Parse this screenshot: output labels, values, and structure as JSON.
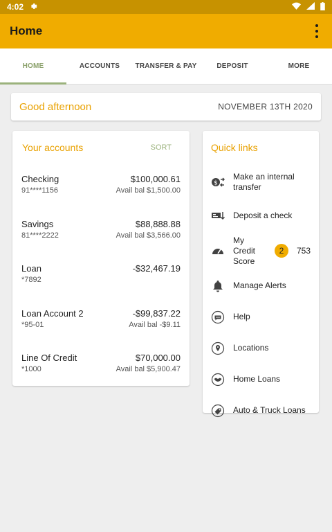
{
  "status": {
    "time": "4:02"
  },
  "appbar": {
    "title": "Home"
  },
  "tabs": [
    {
      "label": "HOME",
      "active": true
    },
    {
      "label": "ACCOUNTS"
    },
    {
      "label": "TRANSFER & PAY"
    },
    {
      "label": "DEPOSIT"
    },
    {
      "label": "MORE"
    }
  ],
  "greeting": {
    "text": "Good afternoon",
    "date": "NOVEMBER 13TH 2020"
  },
  "accounts": {
    "title": "Your accounts",
    "sort_label": "SORT",
    "items": [
      {
        "name": "Checking",
        "number": "91****1156",
        "balance": "$100,000.61",
        "avail": "Avail bal $1,500.00"
      },
      {
        "name": "Savings",
        "number": "81****2222",
        "balance": "$88,888.88",
        "avail": "Avail bal $3,566.00"
      },
      {
        "name": "Loan",
        "number": "*7892",
        "balance": "-$32,467.19",
        "avail": ""
      },
      {
        "name": "Loan Account 2",
        "number": "*95-01",
        "balance": "-$99,837.22",
        "avail": "Avail bal -$9.11"
      },
      {
        "name": "Line Of Credit",
        "number": "*1000",
        "balance": "$70,000.00",
        "avail": "Avail bal $5,900.47"
      }
    ]
  },
  "quick_links": {
    "title": "Quick links",
    "items": [
      {
        "label": "Make an internal transfer",
        "icon": "transfer-icon"
      },
      {
        "label": "Deposit a check",
        "icon": "check-deposit-icon"
      },
      {
        "label": "My Credit Score",
        "icon": "gauge-icon",
        "badge": "2",
        "score": "753"
      },
      {
        "label": "Manage Alerts",
        "icon": "bell-icon"
      },
      {
        "label": "Help",
        "icon": "chat-icon"
      },
      {
        "label": "Locations",
        "icon": "location-pin-icon"
      },
      {
        "label": "Home Loans",
        "icon": "handshake-icon"
      },
      {
        "label": "Auto & Truck Loans",
        "icon": "tag-icon"
      }
    ]
  }
}
